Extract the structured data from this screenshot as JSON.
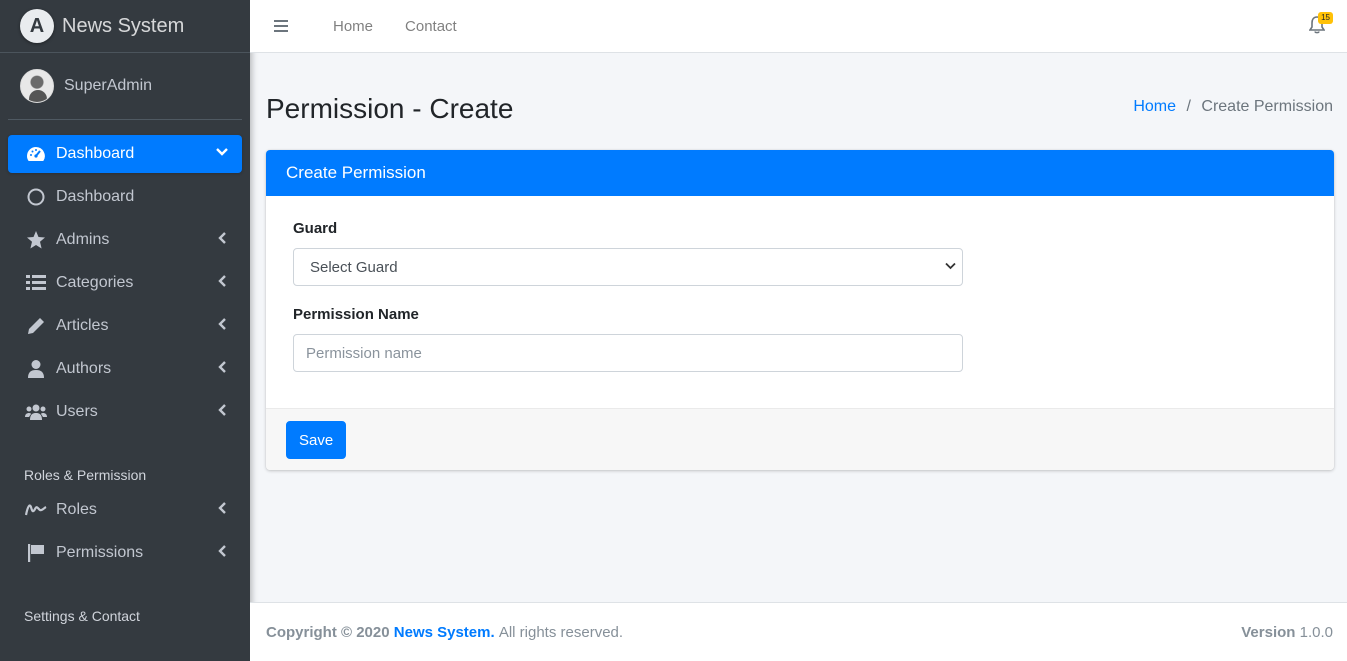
{
  "brand": {
    "name": "News System",
    "logo_letter": "A"
  },
  "user": {
    "name": "SuperAdmin"
  },
  "sidebar": {
    "items": [
      {
        "label": "Dashboard",
        "icon": "tachometer-icon",
        "active": true
      },
      {
        "label": "Dashboard",
        "icon": "circle-icon"
      },
      {
        "label": "Admins",
        "icon": "star-icon"
      },
      {
        "label": "Categories",
        "icon": "list-icon"
      },
      {
        "label": "Articles",
        "icon": "pencil-icon"
      },
      {
        "label": "Authors",
        "icon": "user-icon"
      },
      {
        "label": "Users",
        "icon": "users-icon"
      }
    ],
    "section_roles": "Roles & Permission",
    "roles_items": [
      {
        "label": "Roles",
        "icon": "signature-icon"
      },
      {
        "label": "Permissions",
        "icon": "flag-icon"
      }
    ],
    "section_settings": "Settings & Contact"
  },
  "navbar": {
    "links": [
      "Home",
      "Contact"
    ],
    "notification_count": "15"
  },
  "page": {
    "title": "Permission - Create",
    "breadcrumb": {
      "home": "Home",
      "separator": "/",
      "current": "Create Permission"
    }
  },
  "card": {
    "title": "Create Permission",
    "guard_label": "Guard",
    "guard_selected": "Select Guard",
    "permission_label": "Permission Name",
    "permission_placeholder": "Permission name",
    "permission_value": "",
    "save_label": "Save"
  },
  "footer": {
    "copyright": "Copyright © 2020",
    "brand": "News System.",
    "rights": "All rights reserved.",
    "version_label": "Version",
    "version": "1.0.0"
  },
  "colors": {
    "primary": "#007bff",
    "sidebar": "#343a40",
    "badge": "#ffc107"
  }
}
